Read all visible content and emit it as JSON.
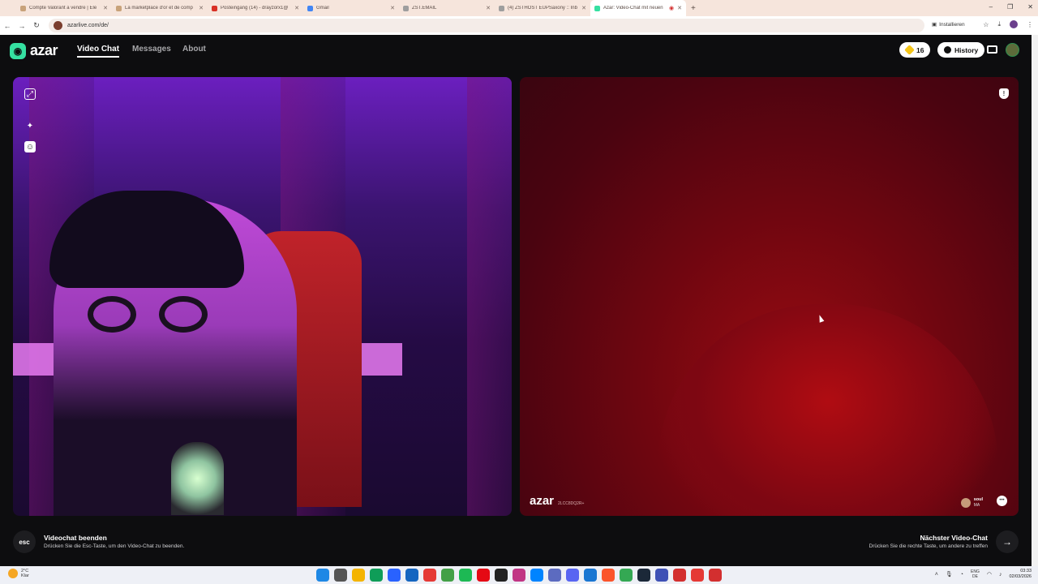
{
  "browser": {
    "tabs": [
      {
        "title": "Compte Valorant a vendre | Ele",
        "icon": "eldorado-icon"
      },
      {
        "title": "La marketplace d'or et de comp",
        "icon": "eldorado-icon"
      },
      {
        "title": "Posteingang (14) - drayzorx1@",
        "icon": "gmail-icon"
      },
      {
        "title": "Gmail",
        "icon": "google-icon"
      },
      {
        "title": "ZST.EMAIL",
        "icon": "zst-icon"
      },
      {
        "title": "(4) ZSTHOST EUPSaxony :: Inb",
        "icon": "zst-icon"
      },
      {
        "title": "Azar: Video-Chat mit neuen",
        "icon": "azar-icon",
        "active": true
      }
    ],
    "new_tab": "+",
    "url": "azarlive.com/de/",
    "install_label": "Installieren",
    "window_controls": [
      "–",
      "❐",
      "✕"
    ]
  },
  "header": {
    "logo_text": "azar",
    "nav": [
      {
        "label": "Video Chat",
        "active": true
      },
      {
        "label": "Messages",
        "active": false
      },
      {
        "label": "About",
        "active": false
      }
    ],
    "gems_count": "16",
    "history_label": "History"
  },
  "video_left": {
    "controls": [
      "expand-icon",
      "magic-wand-icon",
      "sticker-icon"
    ]
  },
  "video_right": {
    "watermark_logo": "azar",
    "watermark_id": "2LCC8DQ2R+",
    "peer_name": "soul",
    "peer_country": "MA",
    "report_icon": "shield-icon"
  },
  "footer": {
    "esc_key": "esc",
    "end_title": "Videochat beenden",
    "end_subtitle": "Drücken Sie die Esc-Taste, um den Video-Chat zu beenden.",
    "next_title": "Nächster Video-Chat",
    "next_subtitle": "Drücken Sie die rechte Taste, um andere zu treffen",
    "next_arrow": "→"
  },
  "taskbar": {
    "weather_temp": "2°C",
    "weather_desc": "Klar",
    "lang_top": "ENG",
    "lang_bottom": "DE",
    "time": "03:33",
    "date": "02/03/2026",
    "apps": [
      {
        "name": "windows-start-icon",
        "color": "#1e88e5"
      },
      {
        "name": "search-icon",
        "color": "#555555"
      },
      {
        "name": "file-explorer-icon",
        "color": "#f4b400"
      },
      {
        "name": "edge-icon",
        "color": "#0f9d58"
      },
      {
        "name": "store-icon",
        "color": "#2962ff"
      },
      {
        "name": "mail-icon",
        "color": "#1565c0"
      },
      {
        "name": "youtube-icon",
        "color": "#e53935"
      },
      {
        "name": "chrome-icon",
        "color": "#43a047"
      },
      {
        "name": "spotify-icon",
        "color": "#1db954"
      },
      {
        "name": "netflix-icon",
        "color": "#e50914"
      },
      {
        "name": "tiktok-icon",
        "color": "#222222"
      },
      {
        "name": "instagram-icon",
        "color": "#c13584"
      },
      {
        "name": "messenger-icon",
        "color": "#0084ff"
      },
      {
        "name": "browser-icon",
        "color": "#5c6bc0"
      },
      {
        "name": "discord-icon",
        "color": "#5865f2"
      },
      {
        "name": "mail-badge-icon",
        "color": "#1976d2"
      },
      {
        "name": "brave-icon",
        "color": "#fb542b"
      },
      {
        "name": "chrome-alt-icon",
        "color": "#34a853"
      },
      {
        "name": "steam-icon",
        "color": "#1b2838"
      },
      {
        "name": "notes-icon",
        "color": "#3f51b5"
      },
      {
        "name": "record-icon",
        "color": "#d32f2f"
      },
      {
        "name": "game-icon",
        "color": "#e53935"
      },
      {
        "name": "target-icon",
        "color": "#d32f2f"
      }
    ]
  },
  "colors": {
    "accent": "#35e0a1",
    "background": "#0d0d0f",
    "gem": "#f5c518"
  }
}
